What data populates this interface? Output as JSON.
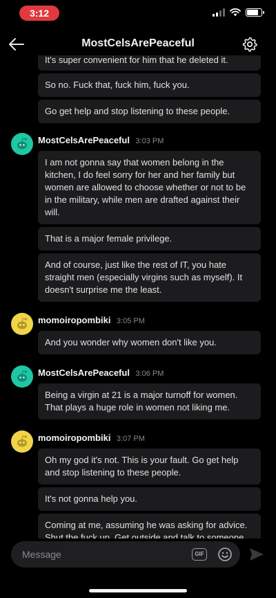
{
  "status_bar": {
    "time": "3:12",
    "battery_level": 0.8
  },
  "header": {
    "title": "MostCelsArePeaceful",
    "back_icon": "arrow-left-icon",
    "settings_icon": "gear-icon"
  },
  "messages": [
    {
      "partial": true,
      "bubbles": [
        "It's super convenient for him that he deleted it.",
        "So no. Fuck that, fuck him, fuck you.",
        "Go get help and stop listening to these people."
      ]
    },
    {
      "sender": "MostCelsArePeaceful",
      "time": "3:03 PM",
      "avatar": "teal",
      "bubbles": [
        "I am not gonna say that women belong in the kitchen, I do feel sorry for her and her family but women are allowed to choose whether or not to be in the military, while men are drafted against their will.",
        "That is a major female privilege.",
        "And of course, just like the rest of IT, you hate straight men (especially virgins such as myself). It doesn't surprise me the least."
      ]
    },
    {
      "sender": "momoiropombiki",
      "time": "3:05 PM",
      "avatar": "yellow",
      "bubbles": [
        "And you wonder why women don't like you."
      ]
    },
    {
      "sender": "MostCelsArePeaceful",
      "time": "3:06 PM",
      "avatar": "teal",
      "bubbles": [
        "Being a virgin at 21 is a major turnoff for women. That plays a huge role in women not liking me."
      ]
    },
    {
      "sender": "momoiropombiki",
      "time": "3:07 PM",
      "avatar": "yellow",
      "bubbles": [
        "Oh my god it's not. This is your fault. Go get help and stop listening to these people.",
        "It's not gonna help you.",
        "Coming at me, assuming he was asking for advice. Shut the fuck up. Get outside and talk to someone. The first person you should talk"
      ]
    }
  ],
  "composer": {
    "placeholder": "Message",
    "gif_label": "GIF"
  },
  "colors": {
    "background": "#000000",
    "bubble": "#1c1c1e",
    "time_pill": "#e0393e",
    "avatar_teal": "#1fc7a4",
    "avatar_yellow": "#f0d44a"
  }
}
